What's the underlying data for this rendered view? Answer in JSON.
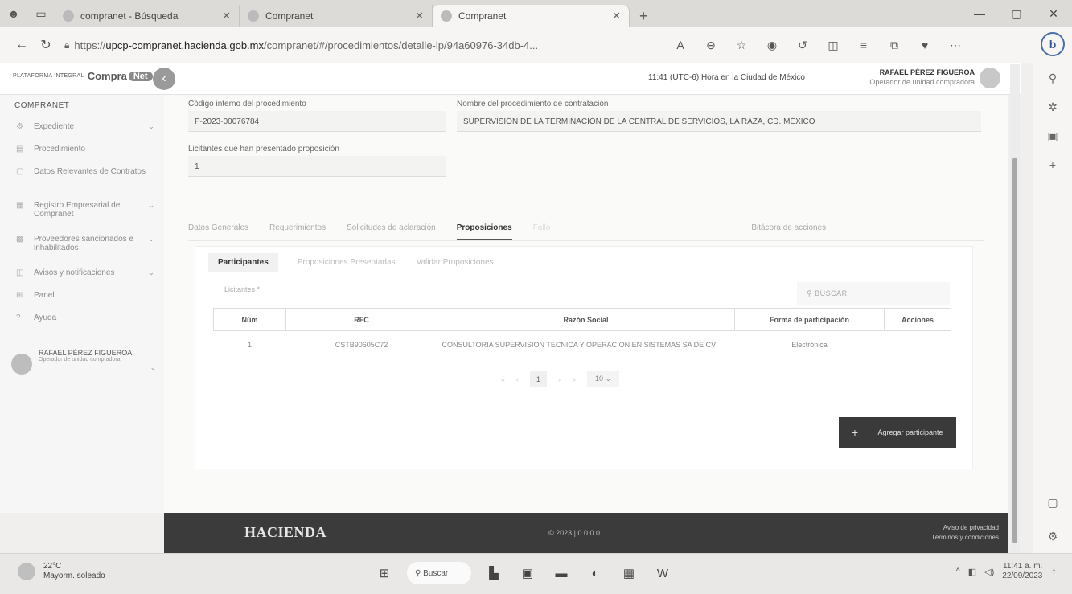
{
  "browser": {
    "tabs": [
      {
        "title": "compranet - Búsqueda",
        "active": false
      },
      {
        "title": "Compranet",
        "active": false
      },
      {
        "title": "Compranet",
        "active": true
      }
    ],
    "url_prefix": "https://",
    "url_host": "upcp-compranet.hacienda.gob.mx",
    "url_path": "/compranet/#/procedimientos/detalle-lp/94a60976-34db-4...",
    "min": "—",
    "restore": "▢",
    "close": "✕"
  },
  "header": {
    "logo_small": "PLATAFORMA INTEGRAL",
    "logo_main": "Compra",
    "logo_net": "Net",
    "hora": "11:41 (UTC-6) Hora en la Ciudad de México",
    "user_name": "RAFAEL PÉREZ FIGUEROA",
    "user_role": "Operador de unidad compradora"
  },
  "sidebar": {
    "title": "COMPRANET",
    "items": [
      {
        "label": "Expediente",
        "icon": "folder-icon",
        "chevron": true
      },
      {
        "label": "Procedimiento",
        "icon": "document-icon",
        "chevron": false
      },
      {
        "label": "Datos Relevantes de Contratos",
        "icon": "clipboard-icon",
        "chevron": false
      },
      {
        "label": "Registro Empresarial de Compranet",
        "icon": "building-icon",
        "chevron": true
      },
      {
        "label": "Proveedores sancionados e inhabilitados",
        "icon": "ban-icon",
        "chevron": true
      },
      {
        "label": "Avisos y notificaciones",
        "icon": "bell-icon",
        "chevron": true
      },
      {
        "label": "Panel",
        "icon": "grid-icon",
        "chevron": false
      },
      {
        "label": "Ayuda",
        "icon": "help-icon",
        "chevron": false
      }
    ],
    "user_name": "RAFAEL PÉREZ FIGUEROA",
    "user_role": "Operador de unidad compradora"
  },
  "procedure": {
    "codigo_label": "Código interno del procedimiento",
    "codigo_value": "P-2023-00076784",
    "nombre_label": "Nombre del procedimiento de contratación",
    "nombre_value": "SUPERVISIÓN DE LA TERMINACIÓN DE LA CENTRAL DE SERVICIOS, LA RAZA, CD. MÉXICO",
    "licitantes_label": "Licitantes que han presentado proposición",
    "licitantes_value": "1"
  },
  "tabs": [
    {
      "label": "Datos Generales",
      "state": "normal"
    },
    {
      "label": "Requerimientos",
      "state": "normal"
    },
    {
      "label": "Solicitudes de aclaración",
      "state": "normal"
    },
    {
      "label": "Proposiciones",
      "state": "active"
    },
    {
      "label": "Fallo",
      "state": "dim"
    },
    {
      "label": "Bitácora de acciones",
      "state": "normal"
    }
  ],
  "subtabs": [
    {
      "label": "Participantes",
      "active": true
    },
    {
      "label": "Proposiciones Presentadas",
      "active": false
    },
    {
      "label": "Validar Proposiciones",
      "active": false
    }
  ],
  "licitantes_label": "Licitantes *",
  "search_label": "BUSCAR",
  "table": {
    "headers": [
      "Núm",
      "RFC",
      "Razón Social",
      "Forma de participación",
      "Acciones"
    ],
    "rows": [
      {
        "num": "1",
        "rfc": "CSTB90605C72",
        "razon": "CONSULTORIA SUPERVISION TECNICA Y OPERACION EN SISTEMAS SA DE CV",
        "forma": "Electrónica",
        "acciones": ""
      }
    ]
  },
  "pager": {
    "page": "1",
    "size": "10"
  },
  "add_button": "Agregar participante",
  "footer": {
    "brand": "HACIENDA",
    "copy": "© 2023 | 0.0.0.0",
    "privacy": "Aviso de privacidad",
    "terms": "Términos y condiciones"
  },
  "taskbar": {
    "temp": "22°C",
    "weather": "Mayorm. soleado",
    "search": "Buscar",
    "time": "11:41 a. m.",
    "date": "22/09/2023"
  }
}
